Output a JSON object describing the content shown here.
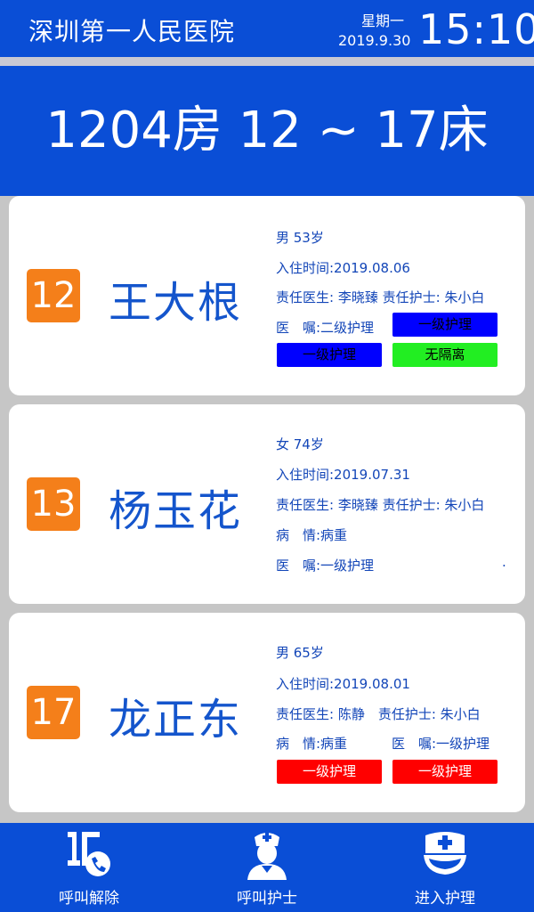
{
  "header": {
    "hospital": "深圳第一人民医院",
    "weekday": "星期一",
    "date": "2019.9.30",
    "time": "15:10"
  },
  "room": {
    "title": "1204房 12 ~ 17床"
  },
  "beds": [
    {
      "bed": "12",
      "name": "王大根",
      "gender_age": "男 53岁",
      "admitted": "入住时间:2019.08.06",
      "staff": "责任医生: 李晓臻 责任护士: 朱小白",
      "order": "医　嘱:二级护理",
      "tags": [
        {
          "label": "一级护理",
          "color": "#0000ff"
        },
        {
          "label": "一级护理",
          "color": "#0000ff"
        },
        {
          "label": "无隔离",
          "color": "#22ee22"
        }
      ]
    },
    {
      "bed": "13",
      "name": "杨玉花",
      "gender_age": "女 74岁",
      "admitted": "入住时间:2019.07.31",
      "staff": "责任医生: 李晓臻 责任护士: 朱小白",
      "condition": "病　情:病重",
      "order": "医　嘱:一级护理",
      "dot": "."
    },
    {
      "bed": "17",
      "name": "龙正东",
      "gender_age": "男 65岁",
      "admitted": "入住时间:2019.08.01",
      "staff": "责任医生: 陈静　责任护士: 朱小白",
      "condition": "病　情:病重",
      "order": "医　嘱:一级护理",
      "tags": [
        {
          "label": "一级护理",
          "color": "#ff0000"
        },
        {
          "label": "一级护理",
          "color": "#ff0000"
        }
      ]
    }
  ],
  "nav": {
    "cancel_call": "呼叫解除",
    "call_nurse": "呼叫护士",
    "enter_care": "进入护理"
  }
}
